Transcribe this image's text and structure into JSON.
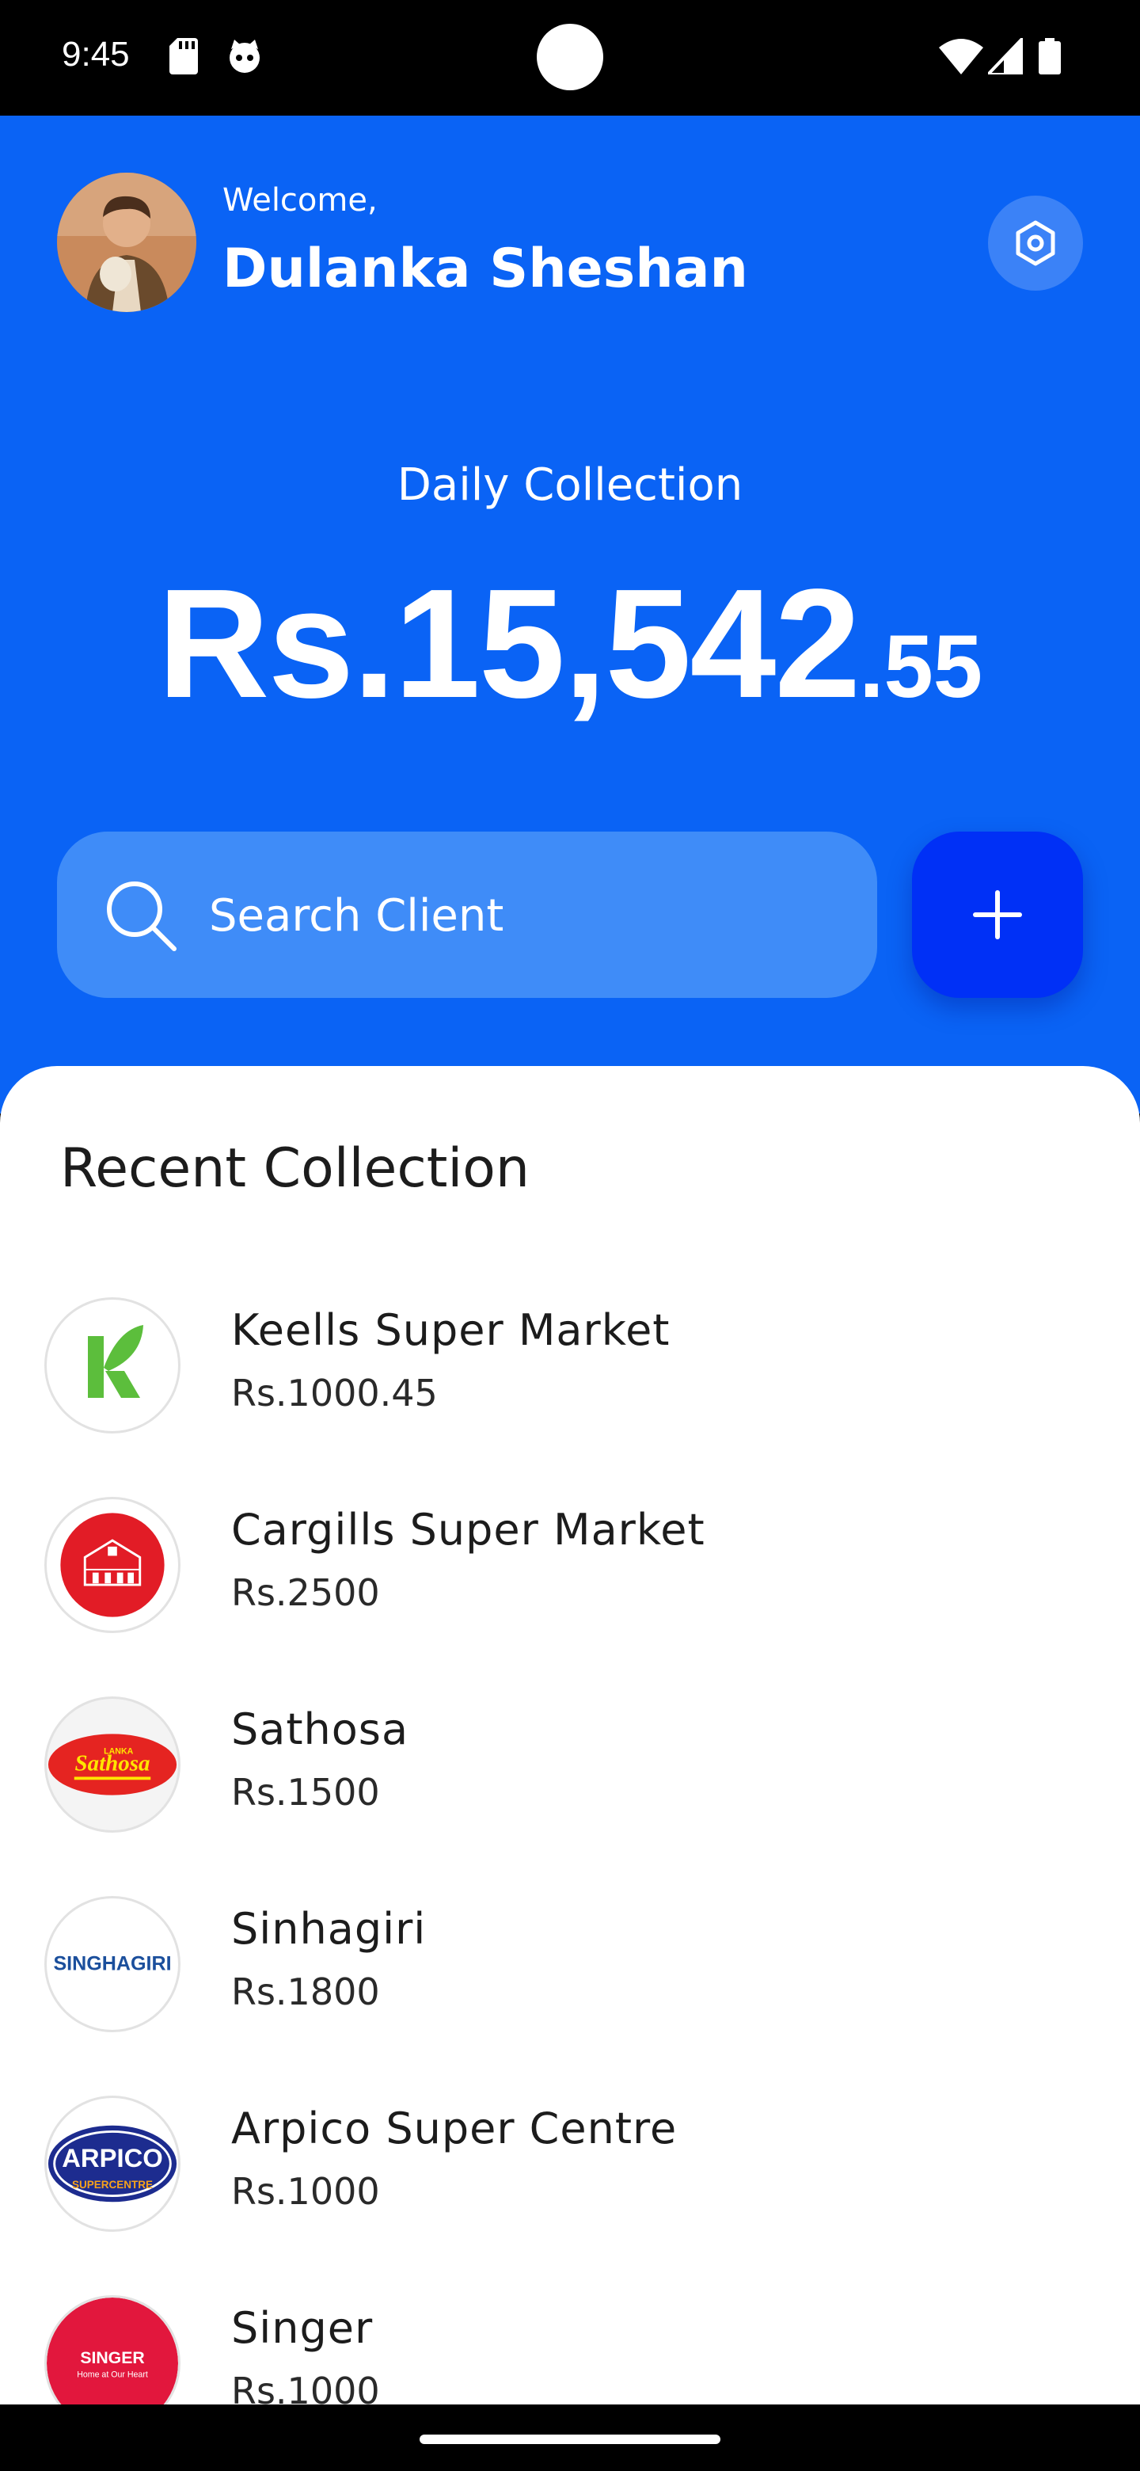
{
  "status_bar": {
    "time": "9:45",
    "left_icons": [
      "sd-card-icon",
      "cat-face-icon"
    ],
    "right_icons": [
      "wifi-icon",
      "signal-icon",
      "battery-icon"
    ]
  },
  "header": {
    "welcome": "Welcome,",
    "user_name": "Dulanka Sheshan",
    "avatar_icon": "user-avatar",
    "settings_icon": "settings-hexagon-icon"
  },
  "summary": {
    "label": "Daily Collection",
    "amount_main": "Rs.15,542",
    "amount_cents": ".55"
  },
  "search": {
    "placeholder": "Search Client",
    "icon": "search-icon"
  },
  "add_button": {
    "icon": "plus-icon"
  },
  "recent": {
    "title": "Recent Collection",
    "items": [
      {
        "name": "Keells Super Market",
        "amount": "Rs.1000.45",
        "logo": "keells-logo"
      },
      {
        "name": "Cargills Super Market",
        "amount": "Rs.2500",
        "logo": "cargills-logo"
      },
      {
        "name": "Sathosa",
        "amount": "Rs.1500",
        "logo": "sathosa-logo",
        "logo_text": "Sathosa",
        "logo_text_top": "LANKA"
      },
      {
        "name": "Sinhagiri",
        "amount": "Rs.1800",
        "logo": "singhagiri-logo",
        "logo_text": "SINGHAGIRI"
      },
      {
        "name": "Arpico Super Centre",
        "amount": "Rs.1000",
        "logo": "arpico-logo",
        "logo_text": "ARPICO",
        "logo_text_bottom": "SUPERCENTRE"
      },
      {
        "name": "Singer",
        "amount": "Rs.1000",
        "logo": "singer-logo",
        "logo_text": "SINGER",
        "logo_text_bottom": "Home at Our Heart"
      }
    ]
  },
  "colors": {
    "hero_blue": "#0a63f5",
    "search_blue": "#3f8cf8",
    "add_button_blue": "#0030f6",
    "sheet_white": "#ffffff"
  }
}
